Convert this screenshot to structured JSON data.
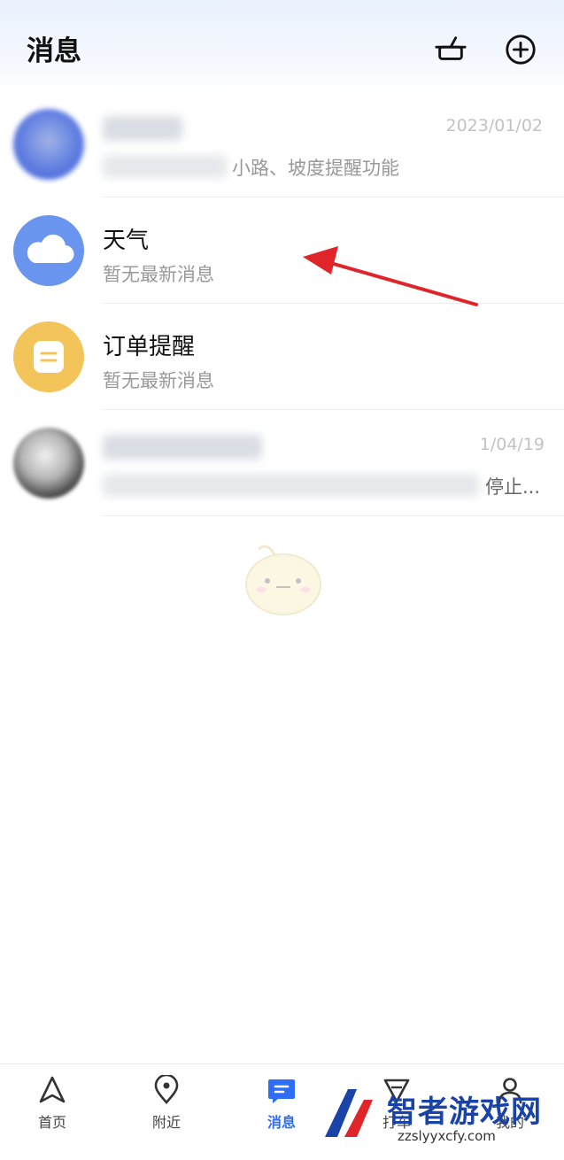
{
  "header": {
    "title": "消息",
    "actions": [
      "broom-icon",
      "add-icon"
    ]
  },
  "messages": [
    {
      "title": "",
      "subtitle": "小路、坡度提醒功能",
      "date": "2023/01/02",
      "avatar_color": "#5b79e0",
      "blurred": true
    },
    {
      "title": "天气",
      "subtitle": "暂无最新消息",
      "date": "",
      "avatar_color": "#6a95ee",
      "icon": "cloud-icon"
    },
    {
      "title": "订单提醒",
      "subtitle": "暂无最新消息",
      "date": "",
      "avatar_color": "#f3c45a",
      "icon": "order-icon"
    },
    {
      "title": "",
      "subtitle": "停止...",
      "date": "1/04/19",
      "avatar_color": "#3a3a3a",
      "blurred": true
    }
  ],
  "tabbar": {
    "items": [
      {
        "label": "首页",
        "icon": "navigation-arrow-icon"
      },
      {
        "label": "附近",
        "icon": "location-pin-icon"
      },
      {
        "label": "消息",
        "icon": "message-icon",
        "active": true
      },
      {
        "label": "打车",
        "icon": "taxi-icon"
      },
      {
        "label": "我的",
        "icon": "user-icon"
      }
    ]
  },
  "watermark": {
    "text": "智者游戏网",
    "url": "zzslyyxcfy.com"
  },
  "colors": {
    "accent": "#2f6df6",
    "annotation_arrow": "#e0252a"
  }
}
